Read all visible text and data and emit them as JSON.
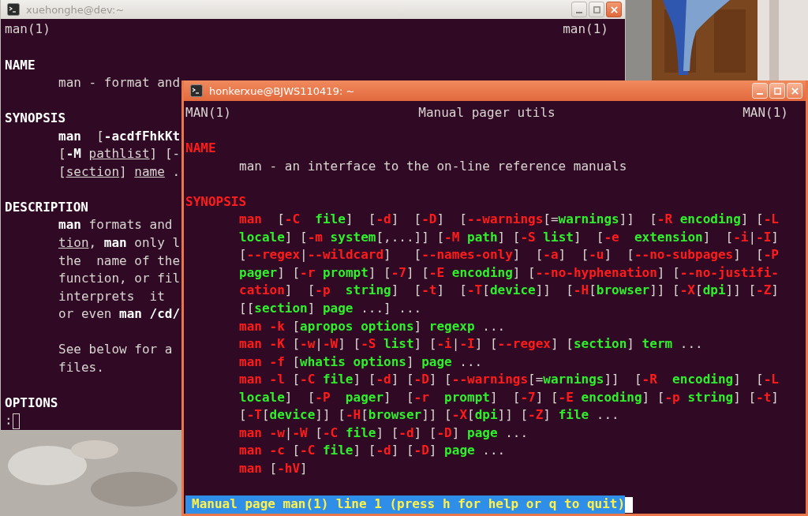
{
  "windows": [
    {
      "active": false,
      "title": "xuehonghe@dev:~",
      "header": {
        "left": "man(1)",
        "right": "man(1)"
      },
      "lines": [
        {
          "kind": "blank"
        },
        {
          "kind": "heading",
          "segments": [
            {
              "kind": "bold",
              "text": "NAME"
            }
          ]
        },
        {
          "kind": "body",
          "segments": [
            {
              "kind": "txt",
              "text": "man - format and"
            }
          ]
        },
        {
          "kind": "blank"
        },
        {
          "kind": "heading",
          "segments": [
            {
              "kind": "bold",
              "text": "SYNOPSIS"
            }
          ]
        },
        {
          "kind": "body",
          "segments": [
            {
              "kind": "bold",
              "text": "man"
            },
            {
              "kind": "txt",
              "text": "  ["
            },
            {
              "kind": "bold",
              "text": "-acdfFhkKt"
            }
          ]
        },
        {
          "kind": "body",
          "segments": [
            {
              "kind": "txt",
              "text": "["
            },
            {
              "kind": "bold",
              "text": "-M "
            },
            {
              "kind": "ul",
              "text": "pathlist"
            },
            {
              "kind": "txt",
              "text": "] [-"
            }
          ]
        },
        {
          "kind": "body",
          "segments": [
            {
              "kind": "txt",
              "text": "["
            },
            {
              "kind": "ul",
              "text": "section"
            },
            {
              "kind": "txt",
              "text": "] "
            },
            {
              "kind": "ul",
              "text": "name"
            },
            {
              "kind": "txt",
              "text": " ."
            }
          ]
        },
        {
          "kind": "blank"
        },
        {
          "kind": "heading",
          "segments": [
            {
              "kind": "bold",
              "text": "DESCRIPTION"
            }
          ]
        },
        {
          "kind": "body",
          "segments": [
            {
              "kind": "bold",
              "text": "man"
            },
            {
              "kind": "txt",
              "text": " formats and"
            }
          ]
        },
        {
          "kind": "body",
          "segments": [
            {
              "kind": "ul",
              "text": "tion"
            },
            {
              "kind": "txt",
              "text": ", "
            },
            {
              "kind": "bold",
              "text": "man"
            },
            {
              "kind": "txt",
              "text": " only l"
            }
          ]
        },
        {
          "kind": "body",
          "segments": [
            {
              "kind": "txt",
              "text": "the  name of the"
            }
          ]
        },
        {
          "kind": "body",
          "segments": [
            {
              "kind": "txt",
              "text": "function, or fil"
            }
          ]
        },
        {
          "kind": "body",
          "segments": [
            {
              "kind": "txt",
              "text": "interprets  it"
            }
          ]
        },
        {
          "kind": "body",
          "segments": [
            {
              "kind": "txt",
              "text": "or even "
            },
            {
              "kind": "bold",
              "text": "man /cd/"
            }
          ]
        },
        {
          "kind": "blank"
        },
        {
          "kind": "body",
          "segments": [
            {
              "kind": "txt",
              "text": "See below for a"
            }
          ]
        },
        {
          "kind": "body",
          "segments": [
            {
              "kind": "txt",
              "text": "files."
            }
          ]
        },
        {
          "kind": "blank"
        },
        {
          "kind": "heading",
          "segments": [
            {
              "kind": "bold",
              "text": "OPTIONS"
            }
          ]
        }
      ],
      "prompt": ":"
    },
    {
      "active": true,
      "title": "honkerxue@BJWS110419: ~",
      "header": {
        "left": "MAN(1)",
        "center": "Manual pager utils",
        "right": "MAN(1)"
      },
      "lines": [
        {
          "kind": "blank"
        },
        {
          "kind": "heading",
          "segments": [
            {
              "kind": "opt",
              "text": "NAME"
            }
          ]
        },
        {
          "kind": "body",
          "segments": [
            {
              "kind": "txt",
              "text": "man - an interface to the on-line reference manuals"
            }
          ]
        },
        {
          "kind": "blank"
        },
        {
          "kind": "heading",
          "segments": [
            {
              "kind": "opt",
              "text": "SYNOPSIS"
            }
          ]
        },
        {
          "kind": "body",
          "segments": [
            {
              "kind": "opt",
              "text": "man"
            },
            {
              "kind": "txt",
              "text": "  ["
            },
            {
              "kind": "opt",
              "text": "-C  "
            },
            {
              "kind": "arg",
              "text": "file"
            },
            {
              "kind": "txt",
              "text": "]  ["
            },
            {
              "kind": "opt",
              "text": "-d"
            },
            {
              "kind": "txt",
              "text": "]  ["
            },
            {
              "kind": "opt",
              "text": "-D"
            },
            {
              "kind": "txt",
              "text": "]  ["
            },
            {
              "kind": "opt",
              "text": "--warnings"
            },
            {
              "kind": "txt",
              "text": "[="
            },
            {
              "kind": "arg",
              "text": "warnings"
            },
            {
              "kind": "txt",
              "text": "]]  ["
            },
            {
              "kind": "opt",
              "text": "-R "
            },
            {
              "kind": "arg",
              "text": "encoding"
            },
            {
              "kind": "txt",
              "text": "] ["
            },
            {
              "kind": "opt",
              "text": "-L"
            }
          ]
        },
        {
          "kind": "body",
          "segments": [
            {
              "kind": "arg",
              "text": "locale"
            },
            {
              "kind": "txt",
              "text": "] ["
            },
            {
              "kind": "opt",
              "text": "-m "
            },
            {
              "kind": "arg",
              "text": "system"
            },
            {
              "kind": "txt",
              "text": "[,...]] ["
            },
            {
              "kind": "opt",
              "text": "-M "
            },
            {
              "kind": "arg",
              "text": "path"
            },
            {
              "kind": "txt",
              "text": "] ["
            },
            {
              "kind": "opt",
              "text": "-S "
            },
            {
              "kind": "arg",
              "text": "list"
            },
            {
              "kind": "txt",
              "text": "]  ["
            },
            {
              "kind": "opt",
              "text": "-e  "
            },
            {
              "kind": "arg",
              "text": "extension"
            },
            {
              "kind": "txt",
              "text": "]  ["
            },
            {
              "kind": "opt",
              "text": "-i"
            },
            {
              "kind": "txt",
              "text": "|"
            },
            {
              "kind": "opt",
              "text": "-I"
            },
            {
              "kind": "txt",
              "text": "]"
            }
          ]
        },
        {
          "kind": "body",
          "segments": [
            {
              "kind": "txt",
              "text": "["
            },
            {
              "kind": "opt",
              "text": "--regex"
            },
            {
              "kind": "txt",
              "text": "|"
            },
            {
              "kind": "opt",
              "text": "--wildcard"
            },
            {
              "kind": "txt",
              "text": "]   ["
            },
            {
              "kind": "opt",
              "text": "--names-only"
            },
            {
              "kind": "txt",
              "text": "]  ["
            },
            {
              "kind": "opt",
              "text": "-a"
            },
            {
              "kind": "txt",
              "text": "]  ["
            },
            {
              "kind": "opt",
              "text": "-u"
            },
            {
              "kind": "txt",
              "text": "]  ["
            },
            {
              "kind": "opt",
              "text": "--no-subpages"
            },
            {
              "kind": "txt",
              "text": "]  ["
            },
            {
              "kind": "opt",
              "text": "-P"
            }
          ]
        },
        {
          "kind": "body",
          "segments": [
            {
              "kind": "arg",
              "text": "pager"
            },
            {
              "kind": "txt",
              "text": "] ["
            },
            {
              "kind": "opt",
              "text": "-r "
            },
            {
              "kind": "arg",
              "text": "prompt"
            },
            {
              "kind": "txt",
              "text": "] ["
            },
            {
              "kind": "opt",
              "text": "-7"
            },
            {
              "kind": "txt",
              "text": "] ["
            },
            {
              "kind": "opt",
              "text": "-E "
            },
            {
              "kind": "arg",
              "text": "encoding"
            },
            {
              "kind": "txt",
              "text": "] ["
            },
            {
              "kind": "opt",
              "text": "--no-hyphenation"
            },
            {
              "kind": "txt",
              "text": "] ["
            },
            {
              "kind": "opt",
              "text": "--no-justifi-"
            }
          ]
        },
        {
          "kind": "body",
          "segments": [
            {
              "kind": "opt",
              "text": "cation"
            },
            {
              "kind": "txt",
              "text": "]  ["
            },
            {
              "kind": "opt",
              "text": "-p  "
            },
            {
              "kind": "arg",
              "text": "string"
            },
            {
              "kind": "txt",
              "text": "]  ["
            },
            {
              "kind": "opt",
              "text": "-t"
            },
            {
              "kind": "txt",
              "text": "]  ["
            },
            {
              "kind": "opt",
              "text": "-T"
            },
            {
              "kind": "txt",
              "text": "["
            },
            {
              "kind": "arg",
              "text": "device"
            },
            {
              "kind": "txt",
              "text": "]]  ["
            },
            {
              "kind": "opt",
              "text": "-H"
            },
            {
              "kind": "txt",
              "text": "["
            },
            {
              "kind": "arg",
              "text": "browser"
            },
            {
              "kind": "txt",
              "text": "]] ["
            },
            {
              "kind": "opt",
              "text": "-X"
            },
            {
              "kind": "txt",
              "text": "["
            },
            {
              "kind": "arg",
              "text": "dpi"
            },
            {
              "kind": "txt",
              "text": "]] ["
            },
            {
              "kind": "opt",
              "text": "-Z"
            },
            {
              "kind": "txt",
              "text": "]"
            }
          ]
        },
        {
          "kind": "body",
          "segments": [
            {
              "kind": "txt",
              "text": "[["
            },
            {
              "kind": "arg",
              "text": "section"
            },
            {
              "kind": "txt",
              "text": "] "
            },
            {
              "kind": "arg",
              "text": "page"
            },
            {
              "kind": "txt",
              "text": " ...] ..."
            }
          ]
        },
        {
          "kind": "body",
          "segments": [
            {
              "kind": "opt",
              "text": "man -k"
            },
            {
              "kind": "txt",
              "text": " ["
            },
            {
              "kind": "arg",
              "text": "apropos options"
            },
            {
              "kind": "txt",
              "text": "] "
            },
            {
              "kind": "arg",
              "text": "regexp"
            },
            {
              "kind": "txt",
              "text": " ..."
            }
          ]
        },
        {
          "kind": "body",
          "segments": [
            {
              "kind": "opt",
              "text": "man -K"
            },
            {
              "kind": "txt",
              "text": " ["
            },
            {
              "kind": "opt",
              "text": "-w"
            },
            {
              "kind": "txt",
              "text": "|"
            },
            {
              "kind": "opt",
              "text": "-W"
            },
            {
              "kind": "txt",
              "text": "] ["
            },
            {
              "kind": "opt",
              "text": "-S "
            },
            {
              "kind": "arg",
              "text": "list"
            },
            {
              "kind": "txt",
              "text": "] ["
            },
            {
              "kind": "opt",
              "text": "-i"
            },
            {
              "kind": "txt",
              "text": "|"
            },
            {
              "kind": "opt",
              "text": "-I"
            },
            {
              "kind": "txt",
              "text": "] ["
            },
            {
              "kind": "opt",
              "text": "--regex"
            },
            {
              "kind": "txt",
              "text": "] ["
            },
            {
              "kind": "arg",
              "text": "section"
            },
            {
              "kind": "txt",
              "text": "] "
            },
            {
              "kind": "arg",
              "text": "term"
            },
            {
              "kind": "txt",
              "text": " ..."
            }
          ]
        },
        {
          "kind": "body",
          "segments": [
            {
              "kind": "opt",
              "text": "man -f"
            },
            {
              "kind": "txt",
              "text": " ["
            },
            {
              "kind": "arg",
              "text": "whatis options"
            },
            {
              "kind": "txt",
              "text": "] "
            },
            {
              "kind": "arg",
              "text": "page"
            },
            {
              "kind": "txt",
              "text": " ..."
            }
          ]
        },
        {
          "kind": "body",
          "segments": [
            {
              "kind": "opt",
              "text": "man -l"
            },
            {
              "kind": "txt",
              "text": " ["
            },
            {
              "kind": "opt",
              "text": "-C "
            },
            {
              "kind": "arg",
              "text": "file"
            },
            {
              "kind": "txt",
              "text": "] ["
            },
            {
              "kind": "opt",
              "text": "-d"
            },
            {
              "kind": "txt",
              "text": "] ["
            },
            {
              "kind": "opt",
              "text": "-D"
            },
            {
              "kind": "txt",
              "text": "] ["
            },
            {
              "kind": "opt",
              "text": "--warnings"
            },
            {
              "kind": "txt",
              "text": "[="
            },
            {
              "kind": "arg",
              "text": "warnings"
            },
            {
              "kind": "txt",
              "text": "]]  ["
            },
            {
              "kind": "opt",
              "text": "-R  "
            },
            {
              "kind": "arg",
              "text": "encoding"
            },
            {
              "kind": "txt",
              "text": "]  ["
            },
            {
              "kind": "opt",
              "text": "-L"
            }
          ]
        },
        {
          "kind": "body",
          "segments": [
            {
              "kind": "arg",
              "text": "locale"
            },
            {
              "kind": "txt",
              "text": "]  ["
            },
            {
              "kind": "opt",
              "text": "-P  "
            },
            {
              "kind": "arg",
              "text": "pager"
            },
            {
              "kind": "txt",
              "text": "]  ["
            },
            {
              "kind": "opt",
              "text": "-r  "
            },
            {
              "kind": "arg",
              "text": "prompt"
            },
            {
              "kind": "txt",
              "text": "]  ["
            },
            {
              "kind": "opt",
              "text": "-7"
            },
            {
              "kind": "txt",
              "text": "] ["
            },
            {
              "kind": "opt",
              "text": "-E "
            },
            {
              "kind": "arg",
              "text": "encoding"
            },
            {
              "kind": "txt",
              "text": "] ["
            },
            {
              "kind": "opt",
              "text": "-p "
            },
            {
              "kind": "arg",
              "text": "string"
            },
            {
              "kind": "txt",
              "text": "] ["
            },
            {
              "kind": "opt",
              "text": "-t"
            },
            {
              "kind": "txt",
              "text": "]"
            }
          ]
        },
        {
          "kind": "body",
          "segments": [
            {
              "kind": "txt",
              "text": "["
            },
            {
              "kind": "opt",
              "text": "-T"
            },
            {
              "kind": "txt",
              "text": "["
            },
            {
              "kind": "arg",
              "text": "device"
            },
            {
              "kind": "txt",
              "text": "]] ["
            },
            {
              "kind": "opt",
              "text": "-H"
            },
            {
              "kind": "txt",
              "text": "["
            },
            {
              "kind": "arg",
              "text": "browser"
            },
            {
              "kind": "txt",
              "text": "]] ["
            },
            {
              "kind": "opt",
              "text": "-X"
            },
            {
              "kind": "txt",
              "text": "["
            },
            {
              "kind": "arg",
              "text": "dpi"
            },
            {
              "kind": "txt",
              "text": "]] ["
            },
            {
              "kind": "opt",
              "text": "-Z"
            },
            {
              "kind": "txt",
              "text": "] "
            },
            {
              "kind": "arg",
              "text": "file"
            },
            {
              "kind": "txt",
              "text": " ..."
            }
          ]
        },
        {
          "kind": "body",
          "segments": [
            {
              "kind": "opt",
              "text": "man -w"
            },
            {
              "kind": "txt",
              "text": "|"
            },
            {
              "kind": "opt",
              "text": "-W"
            },
            {
              "kind": "txt",
              "text": " ["
            },
            {
              "kind": "opt",
              "text": "-C "
            },
            {
              "kind": "arg",
              "text": "file"
            },
            {
              "kind": "txt",
              "text": "] ["
            },
            {
              "kind": "opt",
              "text": "-d"
            },
            {
              "kind": "txt",
              "text": "] ["
            },
            {
              "kind": "opt",
              "text": "-D"
            },
            {
              "kind": "txt",
              "text": "] "
            },
            {
              "kind": "arg",
              "text": "page"
            },
            {
              "kind": "txt",
              "text": " ..."
            }
          ]
        },
        {
          "kind": "body",
          "segments": [
            {
              "kind": "opt",
              "text": "man -c"
            },
            {
              "kind": "txt",
              "text": " ["
            },
            {
              "kind": "opt",
              "text": "-C "
            },
            {
              "kind": "arg",
              "text": "file"
            },
            {
              "kind": "txt",
              "text": "] ["
            },
            {
              "kind": "opt",
              "text": "-d"
            },
            {
              "kind": "txt",
              "text": "] ["
            },
            {
              "kind": "opt",
              "text": "-D"
            },
            {
              "kind": "txt",
              "text": "] "
            },
            {
              "kind": "arg",
              "text": "page"
            },
            {
              "kind": "txt",
              "text": " ..."
            }
          ]
        },
        {
          "kind": "body",
          "segments": [
            {
              "kind": "opt",
              "text": "man"
            },
            {
              "kind": "txt",
              "text": " ["
            },
            {
              "kind": "opt",
              "text": "-hV"
            },
            {
              "kind": "txt",
              "text": "]"
            }
          ]
        },
        {
          "kind": "blank"
        }
      ],
      "status_bar": "Manual page man(1) line 1 (press h for help or q to quit)"
    }
  ]
}
